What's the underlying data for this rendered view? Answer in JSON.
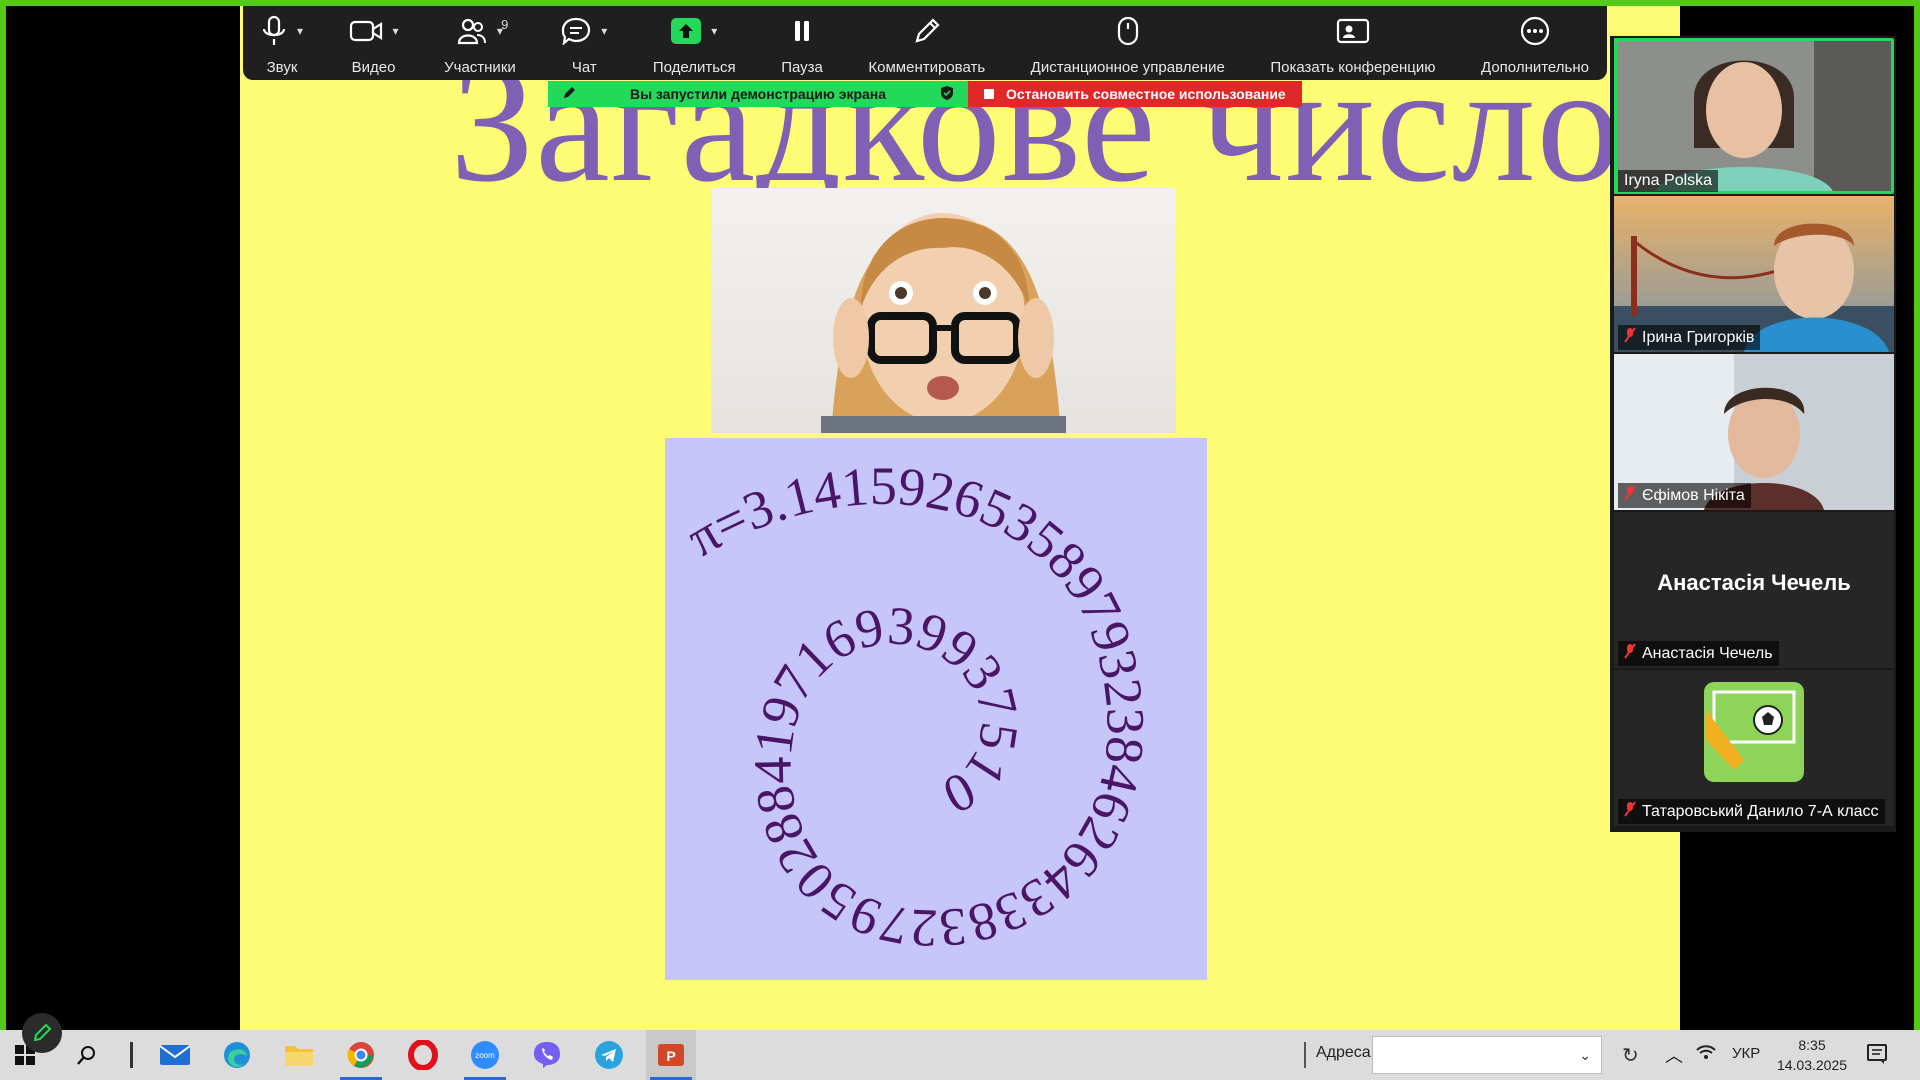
{
  "toolbar": {
    "audio_label": "Звук",
    "video_label": "Видео",
    "participants_label": "Участники",
    "participants_count": "9",
    "chat_label": "Чат",
    "share_label": "Поделиться",
    "pause_label": "Пауза",
    "annotate_label": "Комментировать",
    "remote_label": "Дистанционное управление",
    "show_conf_label": "Показать конференцию",
    "more_label": "Дополнительно"
  },
  "banner": {
    "sharing_message": "Вы запустили демонстрацию экрана",
    "stop_label": "Остановить совместное использование",
    "green_color": "#23d959",
    "red_color": "#e02828"
  },
  "slide": {
    "title": "Загадкове число π",
    "pi_text": "π=3.14159265358979323846264338327950288419716939937510"
  },
  "participants": [
    {
      "name": "Iryna Polska",
      "muted": false,
      "active": true
    },
    {
      "name": "Ірина Григорків",
      "muted": true
    },
    {
      "name": "Єфімов Нікіта",
      "muted": true
    },
    {
      "name": "Анастасія Чечель",
      "muted": true,
      "display_name": "Анастасія Чечель"
    },
    {
      "name": "Татаровський Данило 7-А класс",
      "muted": true
    }
  ],
  "taskbar": {
    "address_label": "Адреса",
    "address_value": "",
    "language": "УКР",
    "time": "8:35",
    "date": "14.03.2025"
  }
}
